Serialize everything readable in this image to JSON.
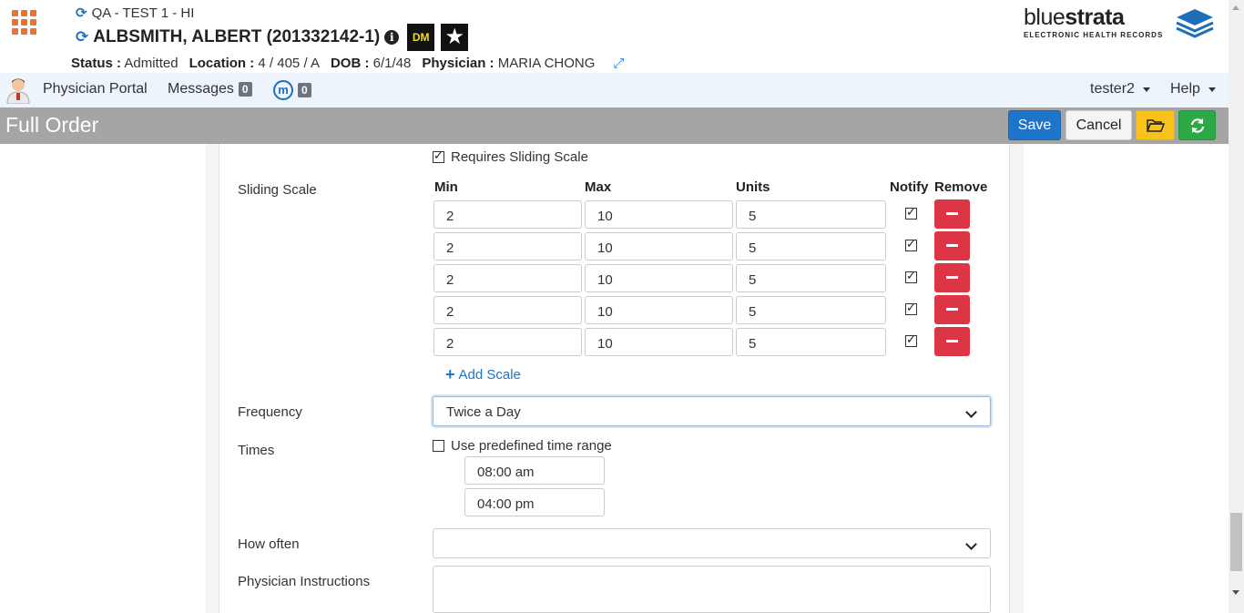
{
  "header": {
    "facility": "QA - TEST 1 - HI",
    "patient_name": "ALBSMITH, ALBERT (201332142-1)",
    "badge_dm": "DM",
    "status_label": "Status :",
    "status_value": "Admitted",
    "location_label": "Location :",
    "location_value": "4 / 405 / A",
    "dob_label": "DOB :",
    "dob_value": "6/1/48",
    "physician_label": "Physician :",
    "physician_value": "MARIA CHONG",
    "logo_light": "blue",
    "logo_bold": "strata",
    "logo_sub": "ELECTRONIC HEALTH RECORDS"
  },
  "nav": {
    "portal": "Physician Portal",
    "messages": "Messages",
    "messages_count": "0",
    "m_icon": "m",
    "m_count": "0",
    "user": "tester2",
    "help": "Help"
  },
  "toolbar": {
    "title": "Full Order",
    "save": "Save",
    "cancel": "Cancel",
    "folder_icon": "folder-open-icon",
    "refresh_icon": "refresh-icon"
  },
  "form": {
    "requires_sliding_scale": {
      "label": "Requires Sliding Scale",
      "checked": true
    },
    "sliding_scale_label": "Sliding Scale",
    "columns": {
      "min": "Min",
      "max": "Max",
      "units": "Units",
      "notify": "Notify",
      "remove": "Remove"
    },
    "rows": [
      {
        "min": "2",
        "max": "10",
        "units": "5",
        "notify": true
      },
      {
        "min": "2",
        "max": "10",
        "units": "5",
        "notify": true
      },
      {
        "min": "2",
        "max": "10",
        "units": "5",
        "notify": true
      },
      {
        "min": "2",
        "max": "10",
        "units": "5",
        "notify": true
      },
      {
        "min": "2",
        "max": "10",
        "units": "5",
        "notify": true
      }
    ],
    "add_scale": "Add Scale",
    "frequency_label": "Frequency",
    "frequency_value": "Twice a Day",
    "times_label": "Times",
    "predefined_range": {
      "label": "Use predefined time range",
      "checked": false
    },
    "times": [
      "08:00 am",
      "04:00 pm"
    ],
    "how_often_label": "How often",
    "how_often_value": "",
    "instructions_label": "Physician Instructions",
    "instructions_value": ""
  },
  "colors": {
    "accent": "#1e74c8",
    "danger": "#dc3545",
    "warning": "#f7c21b",
    "success": "#2aa945",
    "titlebar": "#a5a5a5",
    "orange": "#f0712b"
  }
}
